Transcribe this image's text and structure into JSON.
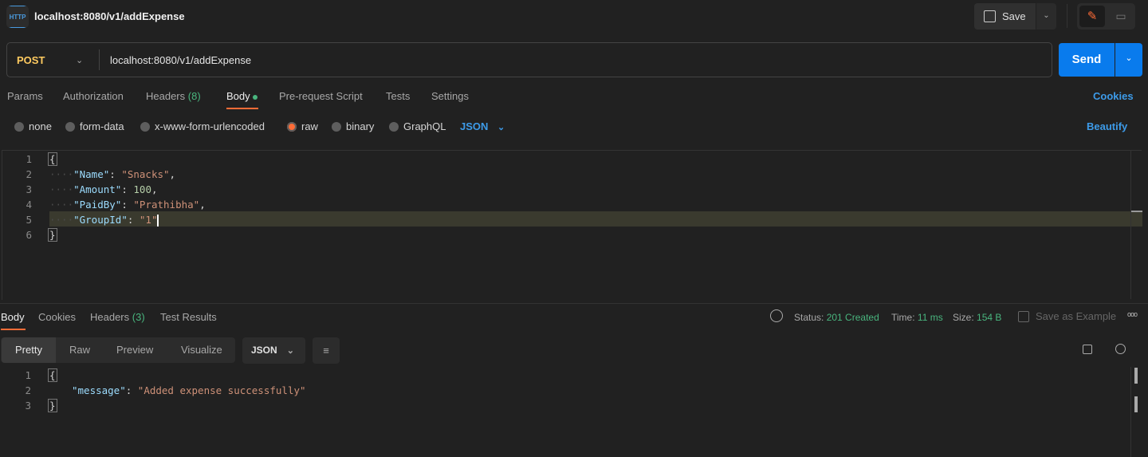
{
  "header": {
    "title": "localhost:8080/v1/addExpense",
    "icon": "http-icon",
    "save_label": "Save"
  },
  "request": {
    "method": "POST",
    "url": "localhost:8080/v1/addExpense",
    "send_label": "Send"
  },
  "tabs": {
    "params": "Params",
    "authorization": "Authorization",
    "headers": "Headers",
    "headers_count": "(8)",
    "body": "Body",
    "prerequest": "Pre-request Script",
    "tests": "Tests",
    "settings": "Settings",
    "cookies": "Cookies"
  },
  "body_modes": {
    "none": "none",
    "form_data": "form-data",
    "urlencoded": "x-www-form-urlencoded",
    "raw": "raw",
    "binary": "binary",
    "graphql": "GraphQL",
    "format": "JSON",
    "beautify": "Beautify",
    "selected": "raw"
  },
  "request_body": {
    "lines": [
      "1",
      "2",
      "3",
      "4",
      "5",
      "6"
    ],
    "open": "{",
    "close": "}",
    "name_key": "\"Name\"",
    "name_val": "\"Snacks\"",
    "amount_key": "\"Amount\"",
    "amount_val": "100",
    "paidby_key": "\"PaidBy\"",
    "paidby_val": "\"Prathibha\"",
    "groupid_key": "\"GroupId\"",
    "groupid_val": "\"1\""
  },
  "response": {
    "tabs": {
      "body": "Body",
      "cookies": "Cookies",
      "headers": "Headers",
      "headers_count": "(3)",
      "tests": "Test Results"
    },
    "status_label": "Status:",
    "status": "201 Created",
    "time_label": "Time:",
    "time": "11 ms",
    "size_label": "Size:",
    "size": "154 B",
    "save_example": "Save as Example",
    "views": {
      "pretty": "Pretty",
      "raw": "Raw",
      "preview": "Preview",
      "visualize": "Visualize"
    },
    "format": "JSON",
    "lines": [
      "1",
      "2",
      "3"
    ],
    "open": "{",
    "close": "}",
    "message_key": "\"message\"",
    "message_val": "\"Added expense successfully\""
  },
  "colors": {
    "accent": "#ff6c37",
    "send": "#097bed",
    "success": "#49b57e",
    "link": "#3d9be9"
  }
}
